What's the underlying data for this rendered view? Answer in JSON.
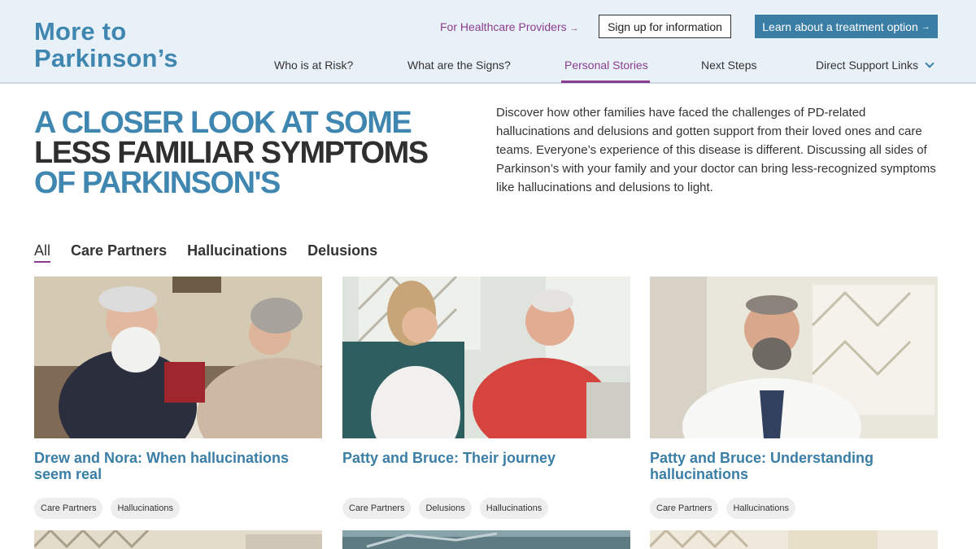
{
  "header": {
    "logo_line1": "More to",
    "logo_line2": "Parkinson’s",
    "hcp_link": "For Healthcare Providers",
    "signup_button": "Sign up for information",
    "learn_button": "Learn about a treatment option",
    "nav": [
      {
        "label": "Who is at Risk?"
      },
      {
        "label": "What are the Signs?"
      },
      {
        "label": "Personal Stories"
      },
      {
        "label": "Next Steps"
      },
      {
        "label": "Direct Support Links"
      }
    ],
    "active_nav": "Personal Stories"
  },
  "hero": {
    "title_line1": "A CLOSER LOOK AT SOME",
    "title_line2": "LESS FAMILIAR SYMPTOMS",
    "title_line3": "OF PARKINSON'S",
    "description": "Discover how other families have faced the challenges of PD-related hallucinations and delusions and gotten support from their loved ones and care teams. Everyone’s experience of this disease is different. Discussing all sides of Parkinson’s with your family and your doctor can bring less-recognized symptoms like hallucinations and delusions to light."
  },
  "filters": [
    "All",
    "Care Partners",
    "Hallucinations",
    "Delusions"
  ],
  "active_filter": "All",
  "cards": [
    {
      "title": "Drew and Nora: When hallucinations seem real",
      "tags": [
        "Care Partners",
        "Hallucinations"
      ]
    },
    {
      "title": "Patty and Bruce: Their journey",
      "tags": [
        "Care Partners",
        "Delusions",
        "Hallucinations"
      ]
    },
    {
      "title": "Patty and Bruce: Understanding hallucinations",
      "tags": [
        "Care Partners",
        "Hallucinations"
      ]
    }
  ],
  "colors": {
    "brand_blue": "#3f87b0",
    "accent_purple": "#8a3d8f",
    "button_blue": "#3a7ea6",
    "header_bg": "#e9f1f8"
  },
  "icons": {
    "hcp_arrow": "→",
    "learn_arrow": "→",
    "dropdown": "chevron-down-icon"
  }
}
